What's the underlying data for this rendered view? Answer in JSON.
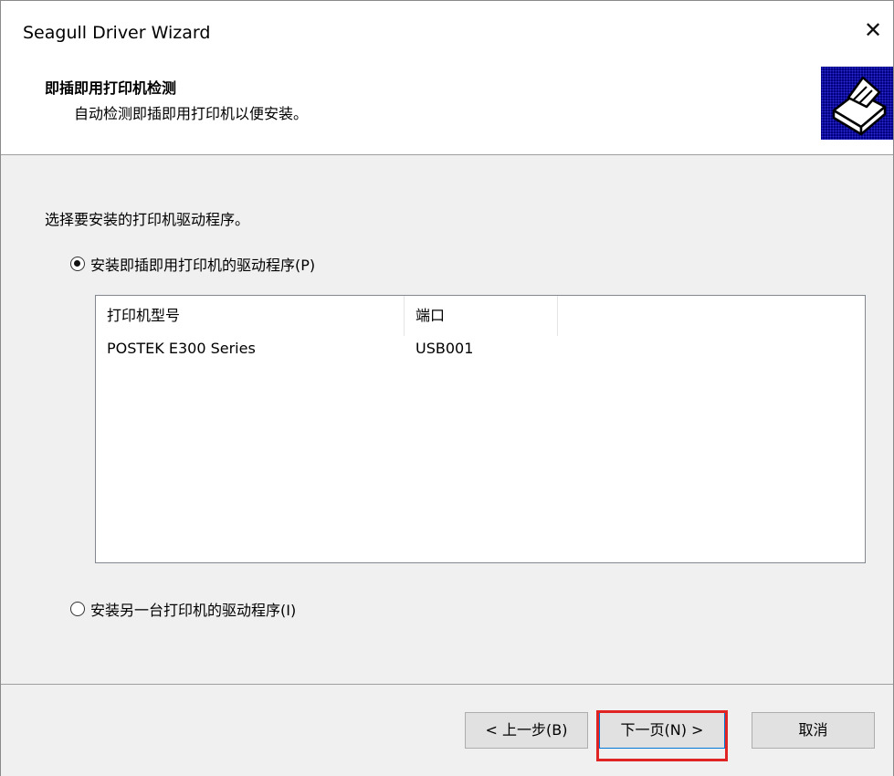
{
  "window": {
    "title": "Seagull Driver Wizard",
    "close_label": "✕"
  },
  "header": {
    "title": "即插即用打印机检测",
    "subtitle": "自动检测即插即用打印机以便安装。"
  },
  "body": {
    "prompt": "选择要安装的打印机驱动程序。",
    "option_pnp": {
      "label": "安装即插即用打印机的驱动程序(P)",
      "checked": true
    },
    "option_other": {
      "label": "安装另一台打印机的驱动程序(I)",
      "checked": false
    }
  },
  "printer_list": {
    "columns": [
      "打印机型号",
      "端口"
    ],
    "rows": [
      {
        "model": "POSTEK E300 Series",
        "port": "USB001"
      }
    ]
  },
  "buttons": {
    "back": "< 上一步(B)",
    "next": "下一页(N) >",
    "cancel": "取消"
  },
  "colors": {
    "highlight": "#e02424",
    "icon_bg": "#000080",
    "focus_border": "#0078d7"
  }
}
